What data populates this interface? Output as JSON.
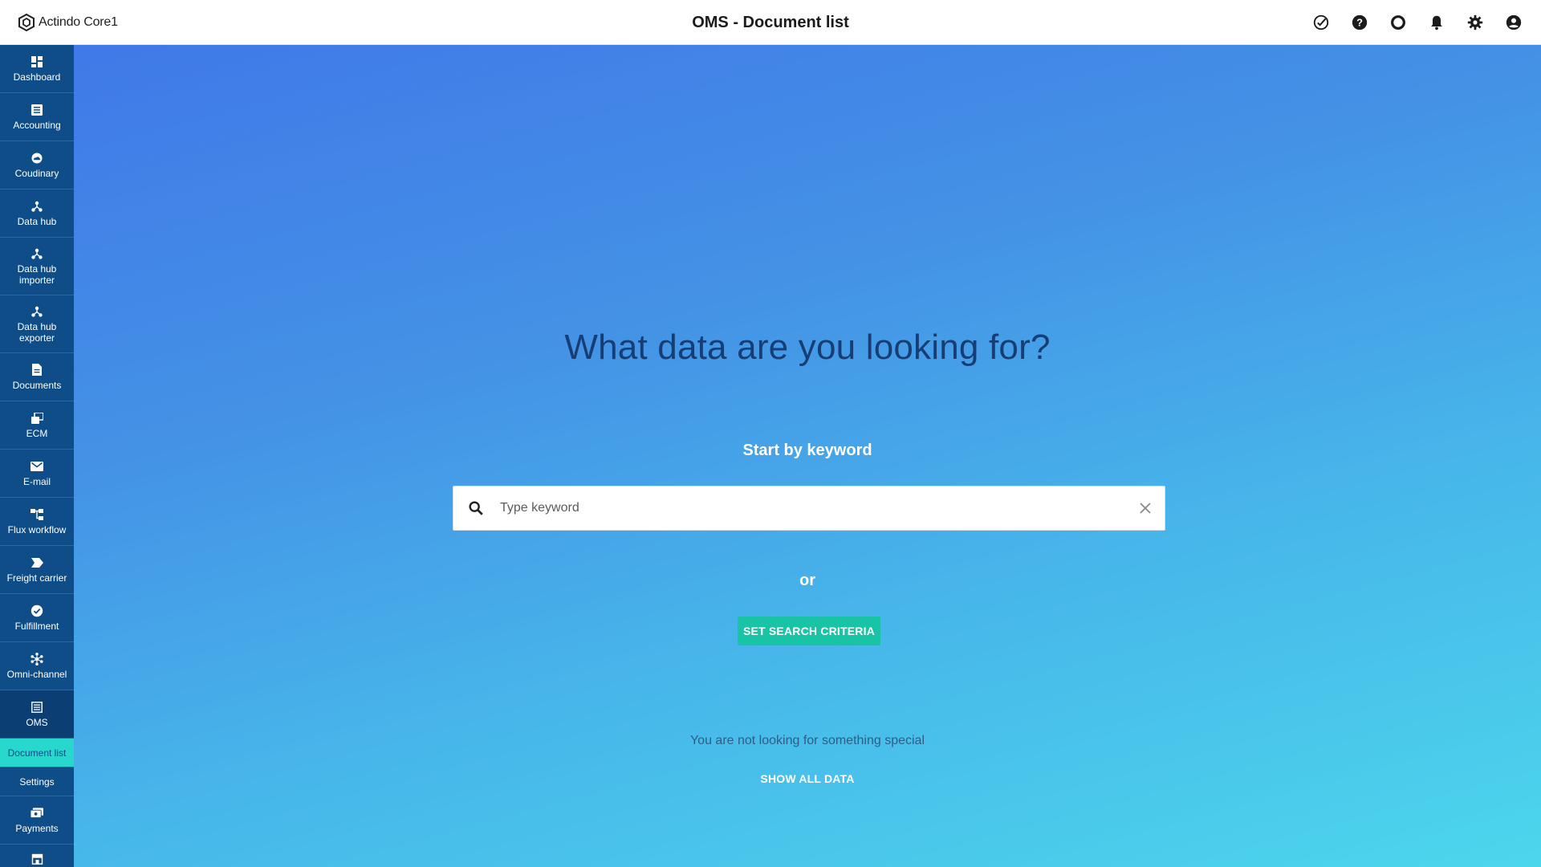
{
  "header": {
    "logo_text": "Actindo Core1",
    "title": "OMS - Document list",
    "icons": [
      "tasks-check-icon",
      "help-icon",
      "circle-icon",
      "bell-icon",
      "gear-icon",
      "account-icon"
    ]
  },
  "sidebar": {
    "items": [
      {
        "label": "Dashboard",
        "icon": "dashboard-icon"
      },
      {
        "label": "Accounting",
        "icon": "list-icon"
      },
      {
        "label": "Coudinary",
        "icon": "cloud-icon"
      },
      {
        "label": "Data hub",
        "icon": "hub-icon"
      },
      {
        "label": "Data hub importer",
        "icon": "hub-icon"
      },
      {
        "label": "Data hub exporter",
        "icon": "hub-icon"
      },
      {
        "label": "Documents",
        "icon": "document-icon"
      },
      {
        "label": "ECM",
        "icon": "copy-icon"
      },
      {
        "label": "E-mail",
        "icon": "mail-icon"
      },
      {
        "label": "Flux workflow",
        "icon": "workflow-icon"
      },
      {
        "label": "Freight carrier",
        "icon": "label-icon"
      },
      {
        "label": "Fulfillment",
        "icon": "verified-icon"
      },
      {
        "label": "Omni-channel",
        "icon": "network-icon"
      },
      {
        "label": "OMS",
        "icon": "oms-icon"
      }
    ],
    "oms_subitems": [
      {
        "label": "Document list",
        "selected": true
      },
      {
        "label": "Settings",
        "selected": false
      }
    ],
    "after_items": [
      {
        "label": "Payments",
        "icon": "payments-icon"
      },
      {
        "label": "",
        "icon": "store-icon"
      }
    ]
  },
  "main": {
    "headline": "What data are you looking for?",
    "subhead": "Start by keyword",
    "search_placeholder": "Type keyword",
    "search_value": "",
    "or_text": "or",
    "criteria_button": "SET SEARCH CRITERIA",
    "not_special_text": "You are not looking for something special",
    "show_all_link": "SHOW ALL DATA"
  },
  "colors": {
    "sidebar_bg": "#0e4d88",
    "selected_sub_bg": "#28d8cc",
    "button_bg": "#19c3a6",
    "gradient_start": "#4079e8",
    "gradient_end": "#4cd6ec"
  }
}
